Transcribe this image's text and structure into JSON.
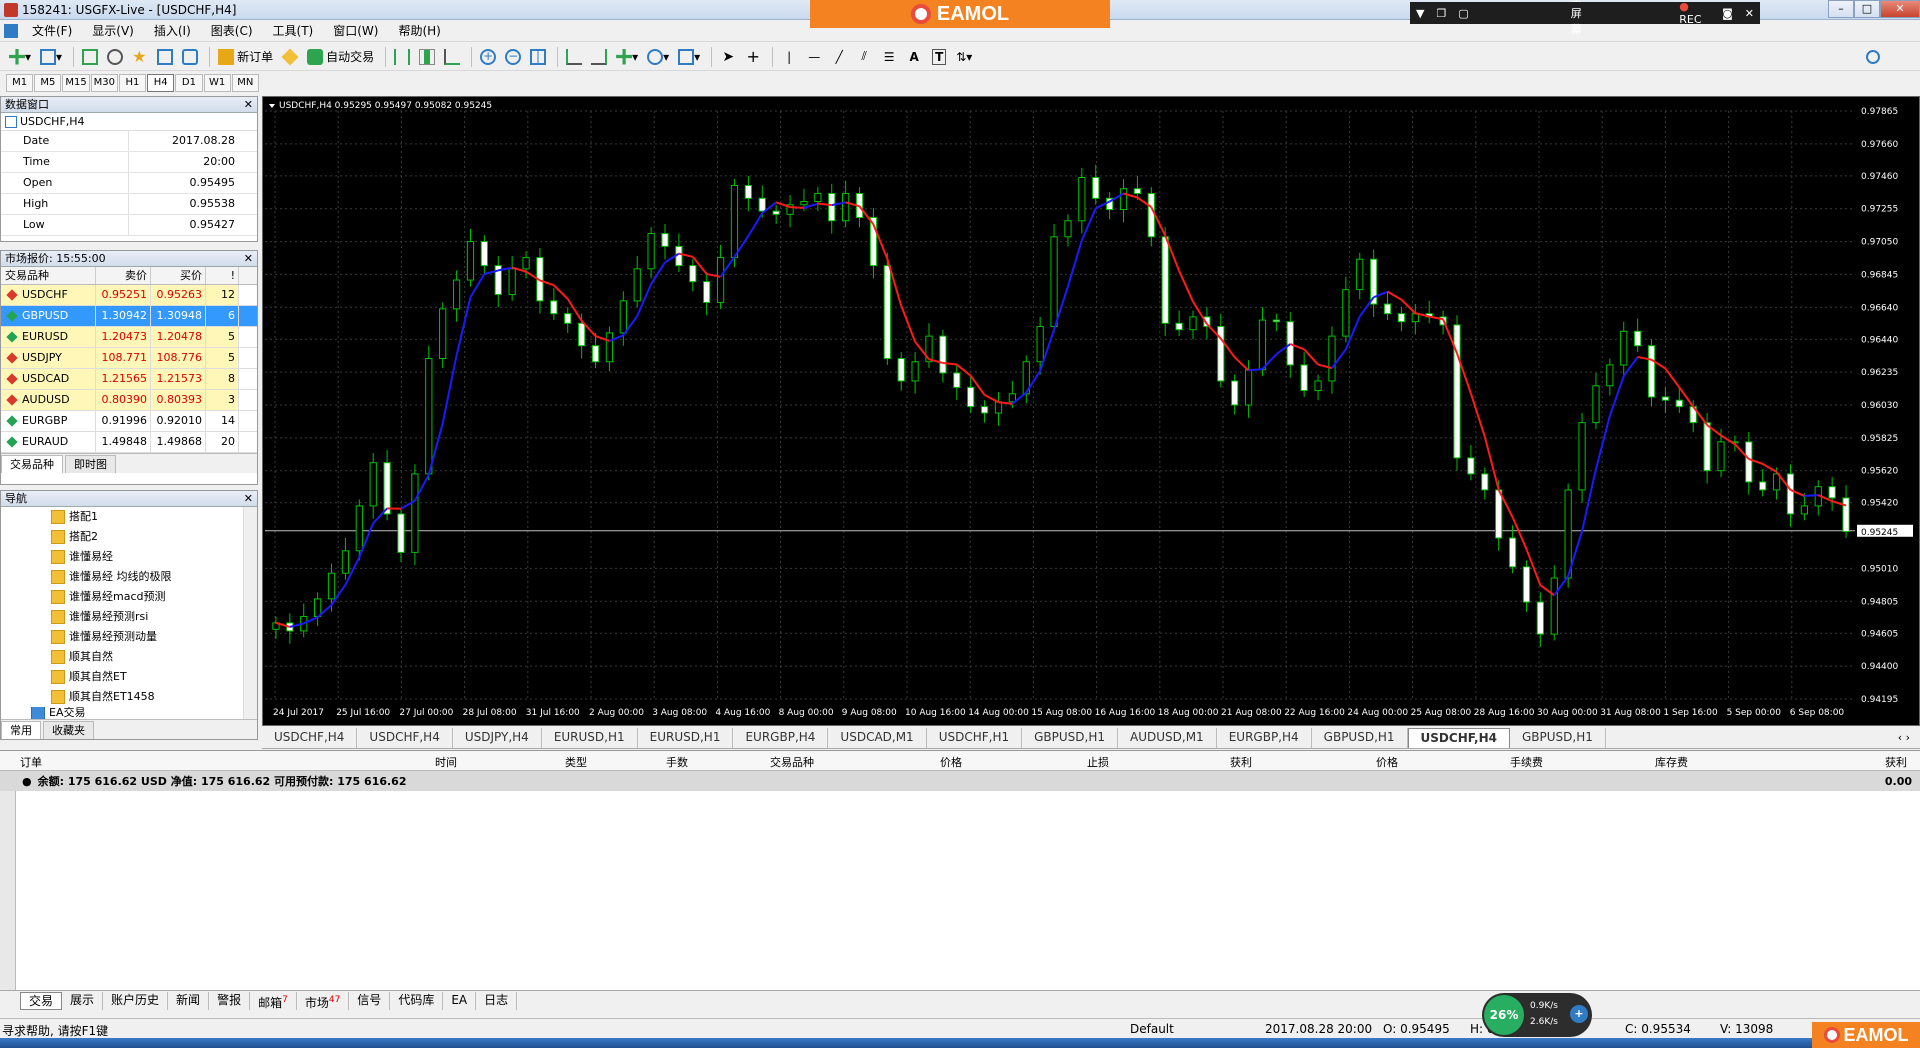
{
  "window": {
    "title": "158241: USGFX-Live - [USDCHF,H4]"
  },
  "overlay": {
    "brand": "EAMOL",
    "fullscreen": "全屏幕",
    "rec": "REC"
  },
  "menu": [
    "文件(F)",
    "显示(V)",
    "插入(I)",
    "图表(C)",
    "工具(T)",
    "窗口(W)",
    "帮助(H)"
  ],
  "toolbar": {
    "new_order": "新订单",
    "auto_trade": "自动交易"
  },
  "timeframes": [
    "M1",
    "M5",
    "M15",
    "M30",
    "H1",
    "H4",
    "D1",
    "W1",
    "MN"
  ],
  "data_window": {
    "title": "数据窗口",
    "symbol": "USDCHF,H4",
    "rows": [
      {
        "k": "Date",
        "v": "2017.08.28"
      },
      {
        "k": "Time",
        "v": "20:00"
      },
      {
        "k": "Open",
        "v": "0.95495"
      },
      {
        "k": "High",
        "v": "0.95538"
      },
      {
        "k": "Low",
        "v": "0.95427"
      }
    ]
  },
  "market_watch": {
    "title": "市场报价: 15:55:00",
    "headers": [
      "交易品种",
      "卖价",
      "买价",
      "!"
    ],
    "rows": [
      {
        "sym": "USDCHF",
        "bid": "0.95251",
        "ask": "0.95263",
        "spr": "12",
        "style": "yellow",
        "dot": "red"
      },
      {
        "sym": "GBPUSD",
        "bid": "1.30942",
        "ask": "1.30948",
        "spr": "6",
        "style": "sel",
        "dot": "green"
      },
      {
        "sym": "EURUSD",
        "bid": "1.20473",
        "ask": "1.20478",
        "spr": "5",
        "style": "yellow",
        "dot": "green"
      },
      {
        "sym": "USDJPY",
        "bid": "108.771",
        "ask": "108.776",
        "spr": "5",
        "style": "yellow",
        "dot": "red"
      },
      {
        "sym": "USDCAD",
        "bid": "1.21565",
        "ask": "1.21573",
        "spr": "8",
        "style": "yellow",
        "dot": "red"
      },
      {
        "sym": "AUDUSD",
        "bid": "0.80390",
        "ask": "0.80393",
        "spr": "3",
        "style": "yellow",
        "dot": "red"
      },
      {
        "sym": "EURGBP",
        "bid": "0.91996",
        "ask": "0.92010",
        "spr": "14",
        "style": "plain",
        "dot": "green"
      },
      {
        "sym": "EURAUD",
        "bid": "1.49848",
        "ask": "1.49868",
        "spr": "20",
        "style": "plain",
        "dot": "green"
      }
    ],
    "tabs": [
      "交易品种",
      "即时图"
    ]
  },
  "navigator": {
    "title": "导航",
    "items": [
      "搭配1",
      "搭配2",
      "谁懂易经",
      "谁懂易经 均线的极限",
      "谁懂易经macd预测",
      "谁懂易经预测rsi",
      "谁懂易经预测动量",
      "顺其自然",
      "顺其自然ET",
      "顺其自然ET1458",
      "EA交易"
    ],
    "tabs": [
      "常用",
      "收藏夹"
    ]
  },
  "chart": {
    "header": "USDCHF,H4  0.95295 0.95497 0.95082 0.95245",
    "bid_label": "0.95245",
    "y_ticks": [
      "0.97865",
      "0.97660",
      "0.97460",
      "0.97255",
      "0.97050",
      "0.96845",
      "0.96640",
      "0.96440",
      "0.96235",
      "0.96030",
      "0.95825",
      "0.95620",
      "0.95420",
      "0.95245",
      "0.95010",
      "0.94805",
      "0.94605",
      "0.94400",
      "0.94195"
    ],
    "x_ticks": [
      "24 Jul 2017",
      "25 Jul 16:00",
      "27 Jul 00:00",
      "28 Jul 08:00",
      "31 Jul 16:00",
      "2 Aug 00:00",
      "3 Aug 08:00",
      "4 Aug 16:00",
      "8 Aug 00:00",
      "9 Aug 08:00",
      "10 Aug 16:00",
      "14 Aug 00:00",
      "15 Aug 08:00",
      "16 Aug 16:00",
      "18 Aug 00:00",
      "21 Aug 08:00",
      "22 Aug 16:00",
      "24 Aug 00:00",
      "25 Aug 08:00",
      "28 Aug 16:00",
      "30 Aug 00:00",
      "31 Aug 08:00",
      "1 Sep 16:00",
      "5 Sep 00:00",
      "6 Sep 08:00"
    ],
    "colors": {
      "bg": "#000000",
      "bull": "#00c000",
      "bear": "#ffffff",
      "grid": "#3a3a3a",
      "ma_up": "#1a1aff",
      "ma_down": "#ff1a1a"
    }
  },
  "chart_data": {
    "type": "candlestick",
    "symbol": "USDCHF",
    "timeframe": "H4",
    "ylim": [
      0.94195,
      0.97865
    ],
    "close": [
      0.9467,
      0.9462,
      0.9471,
      0.9482,
      0.9498,
      0.9512,
      0.954,
      0.9567,
      0.9535,
      0.9511,
      0.956,
      0.9632,
      0.9663,
      0.9681,
      0.9705,
      0.969,
      0.9672,
      0.9688,
      0.9695,
      0.9668,
      0.966,
      0.9654,
      0.964,
      0.963,
      0.9648,
      0.9668,
      0.9688,
      0.971,
      0.9702,
      0.969,
      0.968,
      0.9667,
      0.9695,
      0.974,
      0.9732,
      0.9724,
      0.9722,
      0.9728,
      0.973,
      0.9735,
      0.9718,
      0.9735,
      0.972,
      0.969,
      0.9632,
      0.9618,
      0.963,
      0.9646,
      0.9623,
      0.9614,
      0.9602,
      0.9598,
      0.9605,
      0.961,
      0.963,
      0.9652,
      0.9708,
      0.9718,
      0.9745,
      0.9732,
      0.9725,
      0.9738,
      0.9735,
      0.9708,
      0.9654,
      0.965,
      0.9658,
      0.9652,
      0.9618,
      0.9603,
      0.9625,
      0.9656,
      0.9655,
      0.9628,
      0.9612,
      0.9618,
      0.9646,
      0.9675,
      0.9694,
      0.9666,
      0.966,
      0.9655,
      0.966,
      0.9658,
      0.9653,
      0.957,
      0.956,
      0.955,
      0.952,
      0.9502,
      0.948,
      0.946,
      0.9495,
      0.955,
      0.9592,
      0.9615,
      0.9628,
      0.9649,
      0.964,
      0.9608,
      0.9606,
      0.9602,
      0.9592,
      0.9562,
      0.958,
      0.958,
      0.9555,
      0.955,
      0.956,
      0.9535,
      0.954,
      0.9552,
      0.9545,
      0.9524
    ]
  },
  "chart_tabs": [
    "USDCHF,H4",
    "USDCHF,H4",
    "USDJPY,H4",
    "EURUSD,H1",
    "EURUSD,H1",
    "EURGBP,H4",
    "USDCAD,M1",
    "USDCHF,H1",
    "GBPUSD,H1",
    "AUDUSD,M1",
    "EURGBP,H4",
    "GBPUSD,H1",
    "USDCHF,H4",
    "GBPUSD,H1"
  ],
  "terminal": {
    "headers": [
      "订单",
      "时间",
      "类型",
      "手数",
      "交易品种",
      "价格",
      "止损",
      "获利",
      "价格",
      "手续费",
      "库存费",
      "获利"
    ],
    "balance": "余额: 175 616.62 USD  净值: 175 616.62  可用预付款: 175 616.62",
    "profit_total": "0.00",
    "tabs": [
      {
        "label": "交易",
        "badge": ""
      },
      {
        "label": "展示",
        "badge": ""
      },
      {
        "label": "账户历史",
        "badge": ""
      },
      {
        "label": "新闻",
        "badge": ""
      },
      {
        "label": "警报",
        "badge": ""
      },
      {
        "label": "邮箱",
        "badge": "7"
      },
      {
        "label": "市场",
        "badge": "47"
      },
      {
        "label": "信号",
        "badge": ""
      },
      {
        "label": "代码库",
        "badge": ""
      },
      {
        "label": "EA",
        "badge": ""
      },
      {
        "label": "日志",
        "badge": ""
      }
    ]
  },
  "status": {
    "help": "寻求帮助, 请按F1键",
    "profile": "Default",
    "datetime": "2017.08.28 20:00",
    "open": "O: 0.95495",
    "high": "H: 0",
    "close": "C: 0.95534",
    "volume": "V: 13098"
  },
  "net_widget": {
    "pct": "26%",
    "up": "0.9K/s",
    "down": "2.6K/s"
  }
}
